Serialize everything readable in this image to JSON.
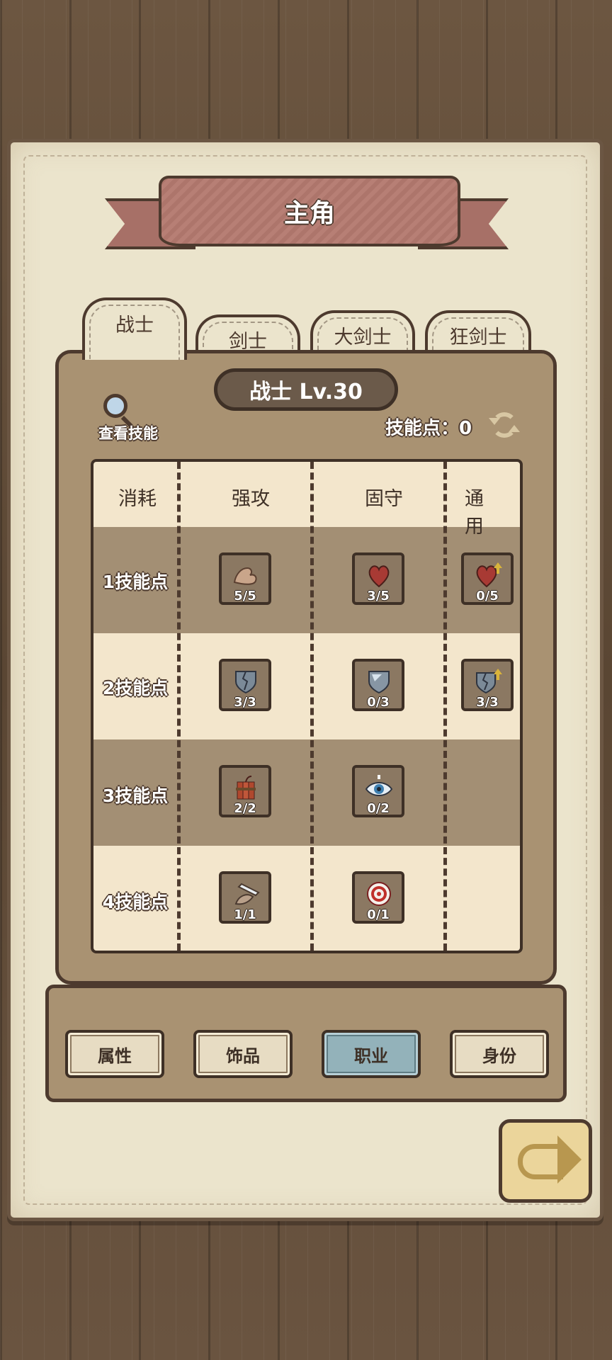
{
  "title": "主角",
  "tabs": [
    {
      "label": "战士",
      "active": true
    },
    {
      "label": "剑士",
      "active": false
    },
    {
      "label": "大剑士",
      "active": false
    },
    {
      "label": "狂剑士",
      "active": false
    }
  ],
  "class_level": "战士 Lv.30",
  "view_skills_label": "查看技能",
  "skill_points_text": "技能点：0",
  "columns": [
    "消耗",
    "强攻",
    "固守",
    "通用"
  ],
  "rows": [
    {
      "label": "1技能点",
      "skills": [
        {
          "icon": "muscle-arm-icon",
          "count": "5/5"
        },
        {
          "icon": "heart-icon",
          "count": "3/5"
        },
        {
          "icon": "heart-upgrade-icon",
          "count": "0/5"
        }
      ]
    },
    {
      "label": "2技能点",
      "skills": [
        {
          "icon": "broken-shield-icon",
          "count": "3/3"
        },
        {
          "icon": "shield-icon",
          "count": "0/3"
        },
        {
          "icon": "broken-shield-upgrade-icon",
          "count": "3/3"
        }
      ]
    },
    {
      "label": "3技能点",
      "skills": [
        {
          "icon": "dynamite-icon",
          "count": "2/2"
        },
        {
          "icon": "eye-icon",
          "count": "0/2"
        }
      ]
    },
    {
      "label": "4技能点",
      "skills": [
        {
          "icon": "sword-slash-icon",
          "count": "1/1"
        },
        {
          "icon": "target-icon",
          "count": "0/1"
        }
      ]
    }
  ],
  "nav": [
    {
      "label": "属性",
      "active": false
    },
    {
      "label": "饰品",
      "active": false
    },
    {
      "label": "职业",
      "active": true
    },
    {
      "label": "身份",
      "active": false
    }
  ],
  "colors": {
    "panel": "#a99272",
    "paper": "#ebe4cc",
    "banner": "#b77f75",
    "active_nav": "#93b2ba",
    "outline": "#4d3a2e"
  }
}
